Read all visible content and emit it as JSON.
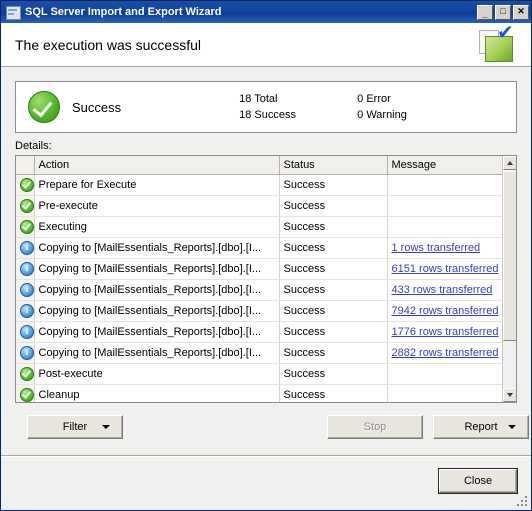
{
  "window": {
    "title": "SQL Server Import and Export Wizard",
    "icon": "wizard-icon",
    "minimize_label": "_",
    "maximize_label": "□",
    "close_label": "✕"
  },
  "header": {
    "title": "The execution was successful"
  },
  "summary": {
    "status_label": "Success",
    "status_icon": "green-check-circle-icon",
    "total_count": "18 Total",
    "success_count": "18 Success",
    "error_count": "0 Error",
    "warning_count": "0 Warning"
  },
  "details": {
    "label": "Details:",
    "columns": [
      "",
      "Action",
      "Status",
      "Message"
    ],
    "rows": [
      {
        "icon": "success",
        "action": "Prepare for Execute",
        "status": "Success",
        "message": "",
        "link": false
      },
      {
        "icon": "success",
        "action": "Pre-execute",
        "status": "Success",
        "message": "",
        "link": false
      },
      {
        "icon": "success",
        "action": "Executing",
        "status": "Success",
        "message": "",
        "link": false
      },
      {
        "icon": "info",
        "action": "Copying to [MailEssentials_Reports].[dbo].[I...",
        "status": "Success",
        "message": "1 rows transferred",
        "link": true
      },
      {
        "icon": "info",
        "action": "Copying to [MailEssentials_Reports].[dbo].[I...",
        "status": "Success",
        "message": "6151 rows transferred",
        "link": true
      },
      {
        "icon": "info",
        "action": "Copying to [MailEssentials_Reports].[dbo].[I...",
        "status": "Success",
        "message": "433 rows transferred",
        "link": true
      },
      {
        "icon": "info",
        "action": "Copying to [MailEssentials_Reports].[dbo].[I...",
        "status": "Success",
        "message": "7942 rows transferred",
        "link": true
      },
      {
        "icon": "info",
        "action": "Copying to [MailEssentials_Reports].[dbo].[I...",
        "status": "Success",
        "message": "1776 rows transferred",
        "link": true
      },
      {
        "icon": "info",
        "action": "Copying to [MailEssentials_Reports].[dbo].[I...",
        "status": "Success",
        "message": "2882 rows transferred",
        "link": true
      },
      {
        "icon": "success",
        "action": "Post-execute",
        "status": "Success",
        "message": "",
        "link": false
      },
      {
        "icon": "success",
        "action": "Cleanup",
        "status": "Success",
        "message": "",
        "link": false
      }
    ]
  },
  "buttons": {
    "filter": "Filter",
    "stop": "Stop",
    "report": "Report",
    "close": "Close"
  },
  "colors": {
    "title_bar": "#0b3c96",
    "link": "#3c3cc8",
    "success_green": "#2f8f12",
    "info_blue": "#1e63b0"
  }
}
